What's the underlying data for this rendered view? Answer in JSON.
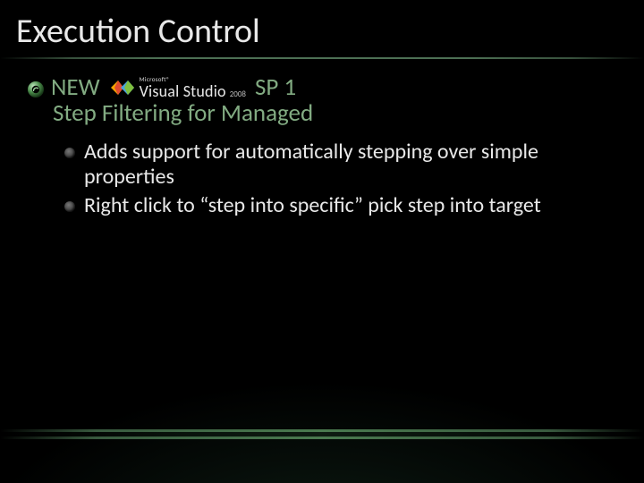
{
  "title": "Execution Control",
  "subhead": {
    "new_label": "NEW",
    "sp_label": "SP 1",
    "line2": "Step Filtering for Managed"
  },
  "vslogo": {
    "microsoft": "Microsoft®",
    "product": "Visual Studio",
    "year": "2008"
  },
  "bullets": [
    "Adds support for automatically stepping over simple properties",
    "Right click to “step into specific” pick step into target"
  ]
}
